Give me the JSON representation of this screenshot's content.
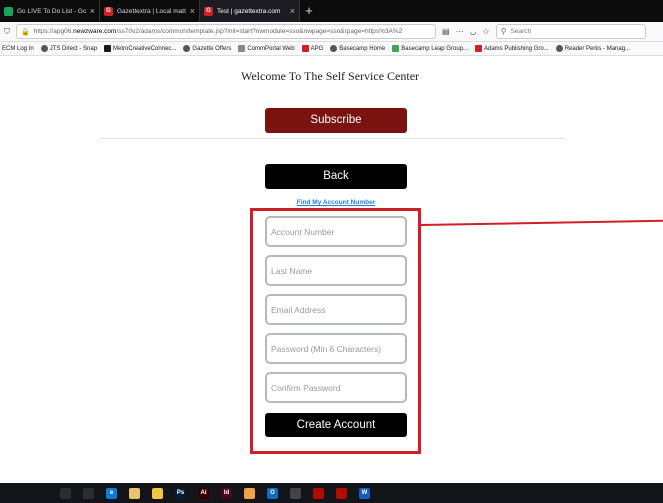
{
  "browser": {
    "tabs": [
      {
        "label": "Go LIVE To Do List - Google Sh",
        "favicon_color": "#1aa260",
        "favicon_char": "",
        "active": false
      },
      {
        "label": "Gazettextra | Local matters",
        "favicon_color": "#d21f26",
        "favicon_char": "G",
        "active": false
      },
      {
        "label": "Test | gazettextra.com",
        "favicon_color": "#d21f26",
        "favicon_char": "G",
        "active": true
      }
    ],
    "url_prefix": "https://apg06.",
    "url_domain": "newzware.com",
    "url_suffix": "/ss70v2/adams/common/template.jsp?init=start?nwmodule=sso&nwpage=sso&rpage=https%3A%2",
    "search_placeholder": "Search",
    "bookmarks": [
      {
        "label": "ECM Log In",
        "color": ""
      },
      {
        "label": "JTS Direct - Snap",
        "color": "#555555"
      },
      {
        "label": "MetroCreativeConnec...",
        "color": "#1a1a1a"
      },
      {
        "label": "Gazette Offers",
        "color": "#555555"
      },
      {
        "label": "CommPortal Web",
        "color": "#888888"
      },
      {
        "label": "APG",
        "color": "#d21f26"
      },
      {
        "label": "Basecamp Home",
        "color": "#555555"
      },
      {
        "label": "Basecamp Leap Group...",
        "color": "#3ba55d"
      },
      {
        "label": "Adams Publishing Gro...",
        "color": "#d21f26"
      },
      {
        "label": "Reader Perks - Manag...",
        "color": "#555555"
      }
    ]
  },
  "page": {
    "welcome": "Welcome To The Self Service Center",
    "subscribe_label": "Subscribe",
    "back_label": "Back",
    "find_account_link": "Find My Account Number",
    "fields": {
      "account_number": {
        "placeholder": "Account Number",
        "value": ""
      },
      "last_name": {
        "placeholder": "Last Name",
        "value": ""
      },
      "email": {
        "placeholder": "Email Address",
        "value": ""
      },
      "password": {
        "placeholder": "Password (Min 6 Characters)",
        "value": ""
      },
      "confirm_password": {
        "placeholder": "Confirm Password",
        "value": ""
      }
    },
    "create_label": "Create Account"
  },
  "colors": {
    "subscribe_bg": "#7b1311",
    "annotation_red": "#d21f26",
    "link_blue": "#1f7fd9"
  },
  "taskbar": {
    "icons": [
      {
        "name": "search-icon",
        "color": "#2b2d33",
        "char": ""
      },
      {
        "name": "task-view-icon",
        "color": "#2b2d33",
        "char": ""
      },
      {
        "name": "edge-icon",
        "color": "#0f7ad8",
        "char": "e"
      },
      {
        "name": "store-icon",
        "color": "#e9c46a",
        "char": ""
      },
      {
        "name": "file-explorer-icon",
        "color": "#f2c744",
        "char": ""
      },
      {
        "name": "photoshop-icon",
        "color": "#001e36",
        "char": "Ps"
      },
      {
        "name": "illustrator-icon",
        "color": "#330000",
        "char": "Ai"
      },
      {
        "name": "indesign-icon",
        "color": "#49021f",
        "char": "Id"
      },
      {
        "name": "app-icon",
        "color": "#f2a444",
        "char": ""
      },
      {
        "name": "outlook-icon",
        "color": "#0f6cbd",
        "char": "O"
      },
      {
        "name": "chrome-icon",
        "color": "#444",
        "char": ""
      },
      {
        "name": "acrobat-icon",
        "color": "#b30b00",
        "char": ""
      },
      {
        "name": "acrobat-pro-icon",
        "color": "#b30b00",
        "char": ""
      },
      {
        "name": "word-icon",
        "color": "#185abd",
        "char": "W"
      }
    ]
  }
}
